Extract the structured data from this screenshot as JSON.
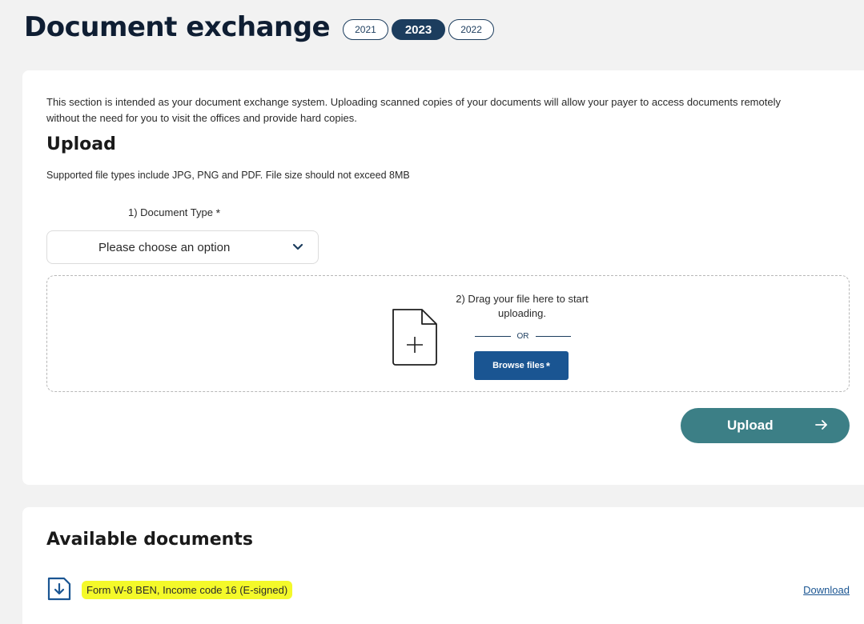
{
  "header": {
    "title": "Document exchange",
    "years": [
      "2021",
      "2023",
      "2022"
    ],
    "active_year": "2023"
  },
  "upload_section": {
    "intro": "This section is intended as your document exchange system. Uploading scanned copies of your documents will allow your payer to access documents remotely without the need for you to visit the offices and provide hard copies.",
    "title": "Upload",
    "file_types_note": "Supported file types include JPG, PNG and PDF. File size should not exceed 8MB",
    "document_type_label": "1) Document Type",
    "required_marker": "*",
    "select_placeholder": "Please choose an option",
    "drag_text": "2) Drag your file here to start uploading.",
    "or_text": "OR",
    "browse_label": "Browse files",
    "upload_label": "Upload"
  },
  "documents_section": {
    "title": "Available documents",
    "items": [
      {
        "name": "Form W-8 BEN, Income code 16 (E-signed)",
        "action": "Download"
      }
    ]
  },
  "colors": {
    "primary_navy": "#1c3d5e",
    "browse_blue": "#1a5592",
    "upload_teal": "#3c7f86",
    "highlight_yellow": "#f4f92a"
  },
  "icons": {
    "select_chevron": "chevron-down-icon",
    "dropzone": "file-add-icon",
    "upload_arrow": "arrow-right-icon",
    "document": "download-document-icon"
  }
}
